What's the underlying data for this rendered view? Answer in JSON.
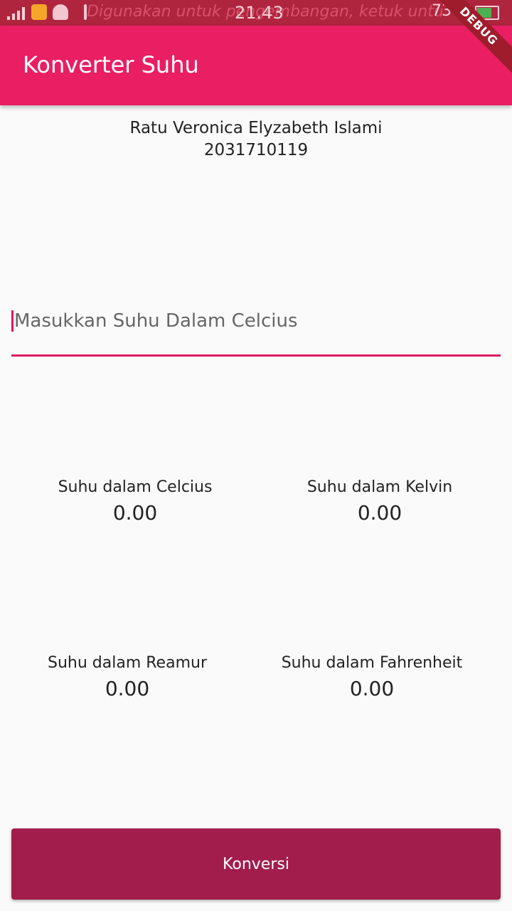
{
  "status_bar": {
    "ticker_text": "Digunakan untuk pengembangan, ketuk untuk",
    "time": "21.43",
    "battery_percent": "73%"
  },
  "app_bar": {
    "title": "Konverter Suhu",
    "debug_banner": "DEBUG"
  },
  "author": {
    "name": "Ratu Veronica Elyzabeth Islami",
    "id": "2031710119"
  },
  "input": {
    "placeholder": "Masukkan Suhu Dalam Celcius",
    "value": ""
  },
  "results": {
    "celcius": {
      "label": "Suhu dalam Celcius",
      "value": "0.00"
    },
    "kelvin": {
      "label": "Suhu dalam Kelvin",
      "value": "0.00"
    },
    "reamur": {
      "label": "Suhu dalam Reamur",
      "value": "0.00"
    },
    "fahrenheit": {
      "label": "Suhu dalam Fahrenheit",
      "value": "0.00"
    }
  },
  "button": {
    "label": "Konversi"
  },
  "colors": {
    "primary": "#e91e63",
    "button": "#a21d4b",
    "status_bar": "#b0253e"
  }
}
